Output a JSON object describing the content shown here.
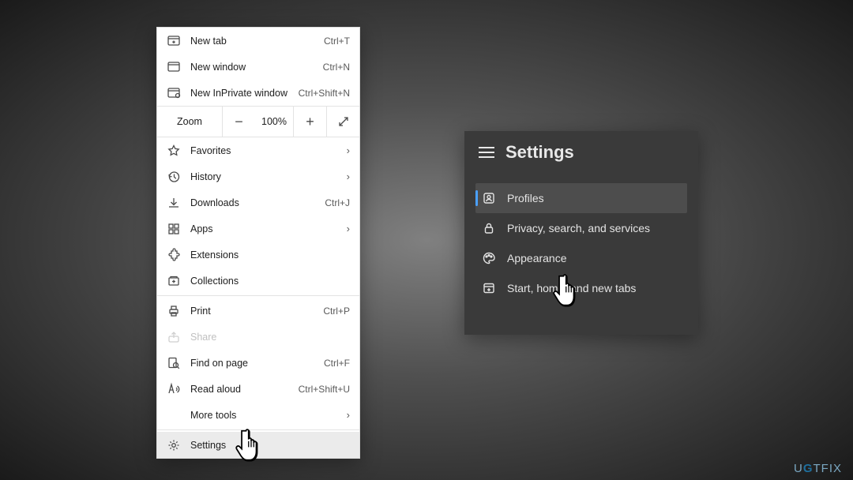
{
  "menu": {
    "newTab": {
      "label": "New tab",
      "shortcut": "Ctrl+T"
    },
    "newWindow": {
      "label": "New window",
      "shortcut": "Ctrl+N"
    },
    "newInPrivate": {
      "label": "New InPrivate window",
      "shortcut": "Ctrl+Shift+N"
    },
    "zoom": {
      "label": "Zoom",
      "value": "100%"
    },
    "favorites": {
      "label": "Favorites"
    },
    "history": {
      "label": "History"
    },
    "downloads": {
      "label": "Downloads",
      "shortcut": "Ctrl+J"
    },
    "apps": {
      "label": "Apps"
    },
    "extensions": {
      "label": "Extensions"
    },
    "collections": {
      "label": "Collections"
    },
    "print": {
      "label": "Print",
      "shortcut": "Ctrl+P"
    },
    "share": {
      "label": "Share"
    },
    "findOnPage": {
      "label": "Find on page",
      "shortcut": "Ctrl+F"
    },
    "readAloud": {
      "label": "Read aloud",
      "shortcut": "Ctrl+Shift+U"
    },
    "moreTools": {
      "label": "More tools"
    },
    "settings": {
      "label": "Settings"
    }
  },
  "settingsPanel": {
    "title": "Settings",
    "items": {
      "profiles": {
        "label": "Profiles"
      },
      "privacy": {
        "label": "Privacy, search, and services"
      },
      "appearance": {
        "label": "Appearance"
      },
      "start": {
        "label": "Start, home, and new tabs"
      }
    }
  },
  "watermark": {
    "prefix": "U",
    "mid": "G",
    "suffix": "TFIX"
  }
}
